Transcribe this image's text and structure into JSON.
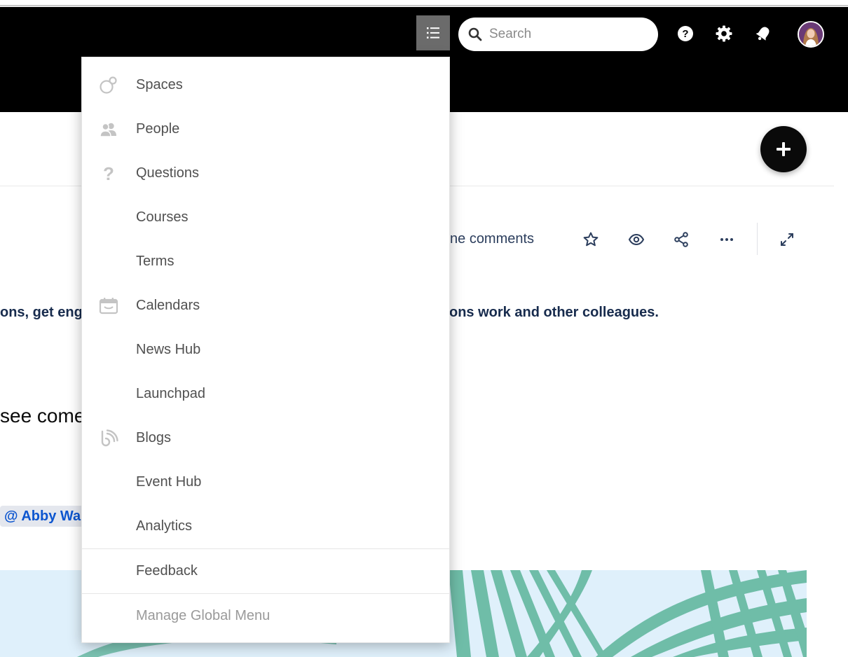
{
  "header": {
    "search_placeholder": "Search"
  },
  "page": {
    "inline_comments": "nline comments",
    "line1_left": "ons, get eng",
    "line1_right": "ons work and other colleagues.",
    "big_text": "see come",
    "mention": "@ Abby Wa"
  },
  "menu": {
    "items": [
      {
        "label": "Spaces",
        "icon": "spaces-icon"
      },
      {
        "label": "People",
        "icon": "people-icon"
      },
      {
        "label": "Questions",
        "icon": "question-icon"
      },
      {
        "label": "Courses",
        "icon": ""
      },
      {
        "label": "Terms",
        "icon": ""
      },
      {
        "label": "Calendars",
        "icon": "calendar-icon"
      },
      {
        "label": "News Hub",
        "icon": ""
      },
      {
        "label": "Launchpad",
        "icon": ""
      },
      {
        "label": "Blogs",
        "icon": "blog-icon"
      },
      {
        "label": "Event Hub",
        "icon": ""
      },
      {
        "label": "Analytics",
        "icon": ""
      }
    ],
    "feedback": "Feedback",
    "manage": "Manage Global Menu"
  },
  "colors": {
    "header_bg": "#000000",
    "menu_toggle_bg": "#6b6b6b",
    "mention_text": "#0c55cf",
    "banner_bg": "#dff0fb",
    "palm_leaf": "#6fbda8"
  }
}
